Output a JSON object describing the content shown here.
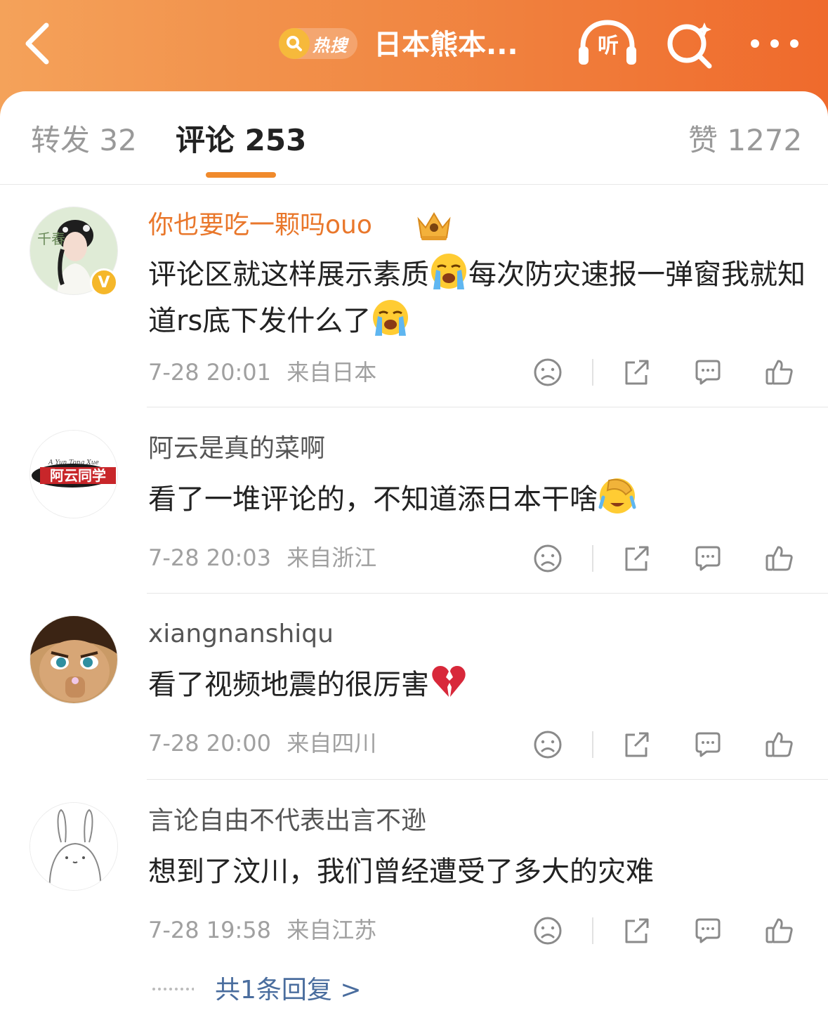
{
  "header": {
    "hot_search_label": "热搜",
    "title": "日本熊本...",
    "listen_label": "听"
  },
  "tabs": {
    "repost": "转发 32",
    "comments": "评论 253",
    "likes": "赞 1272"
  },
  "comments": [
    {
      "user": "你也要吃一颗吗ouo",
      "text_before": "评论区就这样展示素质",
      "text_mid": "每次防灾速报一弹窗我就知道rs底下发什么了",
      "time": "7-28 20:01",
      "location": "来自日本",
      "verified_badge": "V"
    },
    {
      "user": "阿云是真的菜啊",
      "text_before": "看了一堆评论的，不知道添日本干啥",
      "time": "7-28 20:03",
      "location": "来自浙江"
    },
    {
      "user": "xiangnanshiqu",
      "text_before": "看了视频地震的很厉害",
      "time": "7-28 20:00",
      "location": "来自四川"
    },
    {
      "user": "言论自由不代表出言不逊",
      "text_before": "想到了汶川，我们曾经遭受了多大的灾难",
      "time": "7-28 19:58",
      "location": "来自江苏"
    }
  ],
  "reply_link": "共1条回复 >",
  "avatar_texts": {
    "c1_top": "千春",
    "c2_banner": "阿云同学",
    "c2_script": "A Yun Tong Xue"
  },
  "icons": {
    "back": "chevron-left-icon",
    "search": "search-icon",
    "more": "more-dots-icon",
    "listen": "headphones-icon",
    "crown": "crown-icon",
    "dislike": "sad-face-icon",
    "share": "share-icon",
    "reply": "comment-bubble-icon",
    "like": "thumbs-up-icon",
    "emoji_cry": "crying-face-emoji",
    "emoji_facepalm": "facepalm-laugh-emoji",
    "emoji_broken_heart": "broken-heart-emoji"
  },
  "colors": {
    "header_gradient_start": "#f4a25a",
    "header_gradient_end": "#ef6a2c",
    "tab_underline": "#f08a2c",
    "vip_username": "#e9772b",
    "reply_link": "#4a6d9e"
  }
}
